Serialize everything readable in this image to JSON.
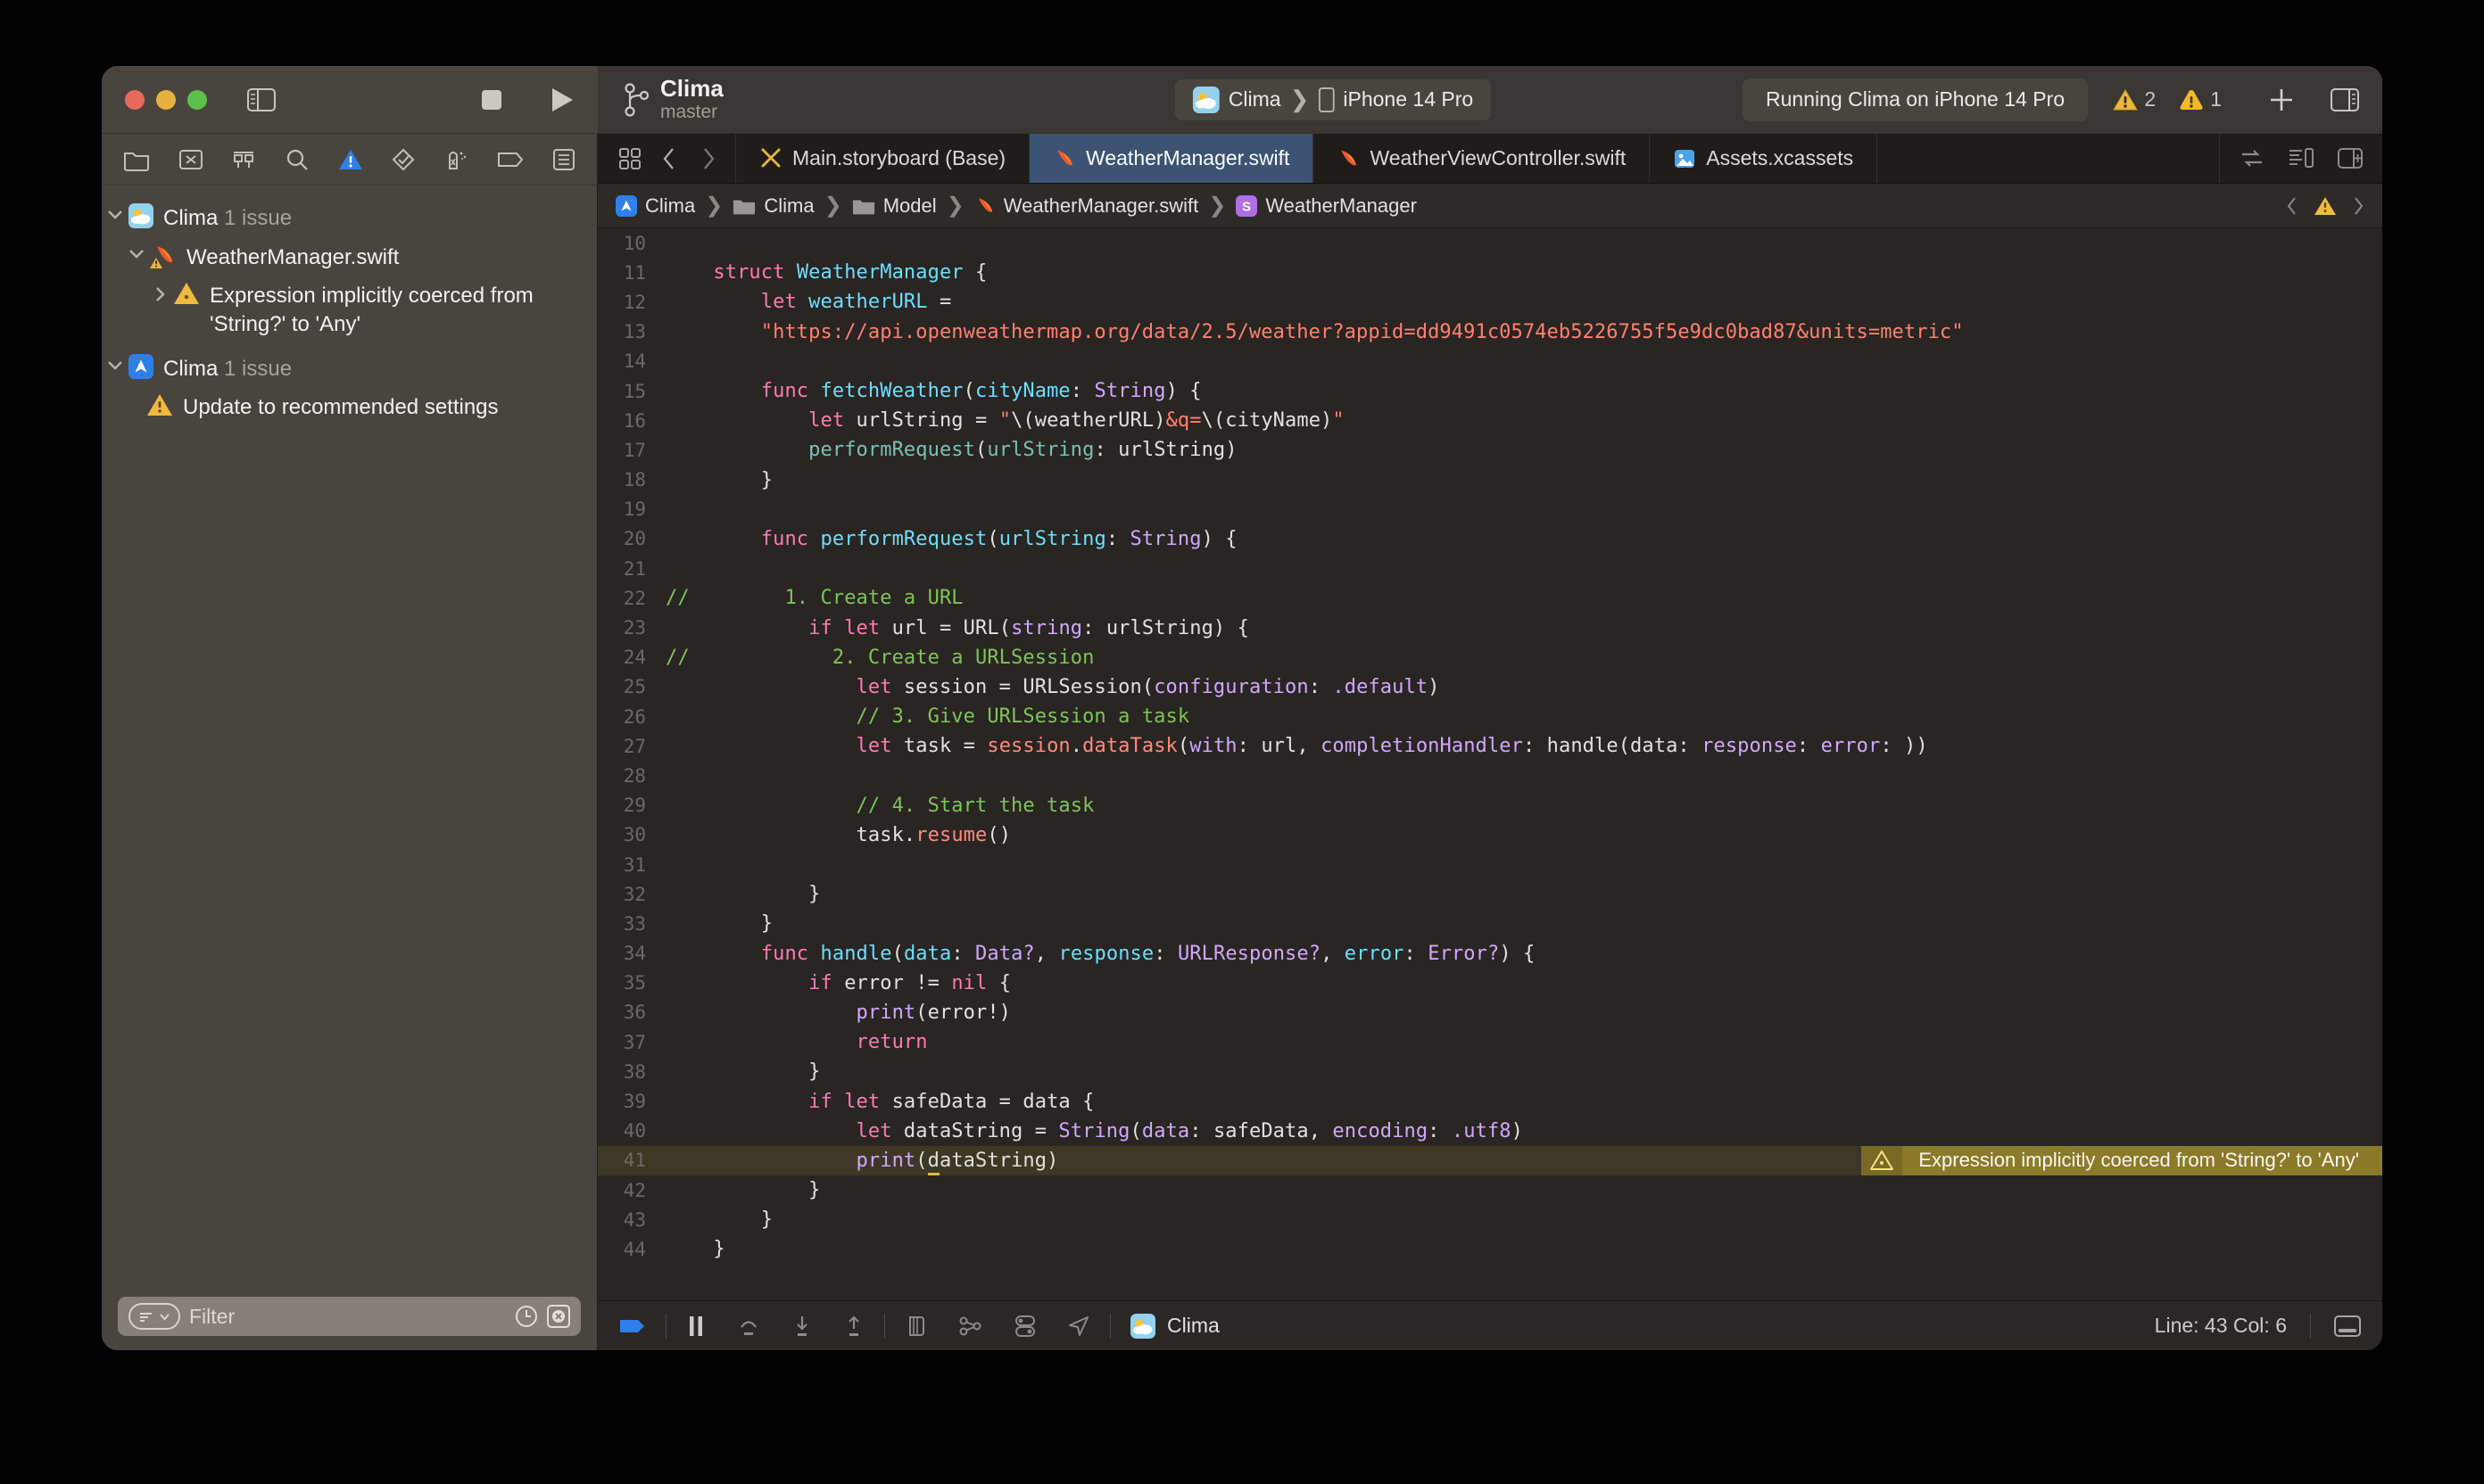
{
  "titlebar": {
    "branch": {
      "project": "Clima",
      "branch_name": "master",
      "icon": "source-control-icon"
    },
    "scheme": {
      "scheme_name": "Clima",
      "destination": "iPhone 14 Pro",
      "separator": "❯"
    },
    "status": "Running Clima on iPhone 14 Pro",
    "badges": [
      {
        "icon": "warning-triangle-icon",
        "count": "2"
      },
      {
        "icon": "warning-round-icon",
        "count": "1"
      }
    ],
    "right_buttons": [
      "add-icon",
      "inspector-toggle-icon"
    ],
    "window_controls": [
      "close",
      "minimize",
      "zoom"
    ],
    "sidebar_toggle": "sidebar-toggle-icon",
    "run_controls": [
      "stop-icon",
      "run-icon"
    ]
  },
  "navigator": {
    "toolbar_icons": [
      "project-navigator-icon",
      "source-control-navigator-icon",
      "symbol-navigator-icon",
      "find-navigator-icon",
      "issue-navigator-icon",
      "test-navigator-icon",
      "debug-navigator-icon",
      "breakpoint-navigator-icon",
      "report-navigator-icon"
    ],
    "active_toolbar_icon": "issue-navigator-icon",
    "tree": [
      {
        "level": 0,
        "twisty": "down",
        "icon": "clima-app-icon",
        "label": "Clima",
        "count": "1 issue"
      },
      {
        "level": 1,
        "twisty": "down",
        "icon": "swift-file-warning-icon",
        "label": "WeatherManager.swift",
        "count": ""
      },
      {
        "level": 2,
        "twisty": "right",
        "icon": "warning-triangle-icon",
        "label": "Expression implicitly coerced from 'String?' to 'Any'",
        "count": ""
      },
      {
        "level": 0,
        "twisty": "down",
        "icon": "xcode-target-icon",
        "label": "Clima",
        "count": "1 issue"
      },
      {
        "level": 1,
        "twisty": "none",
        "icon": "warning-triangle-icon",
        "label": "Update to recommended settings",
        "count": ""
      }
    ],
    "filter": {
      "placeholder": "Filter",
      "chip_icon": "filter-chip-icon",
      "right_icons": [
        "recent-clock-icon",
        "errors-only-icon"
      ]
    }
  },
  "editor": {
    "tabs": [
      {
        "label": "Main.storyboard (Base)",
        "icon": "storyboard-icon",
        "active": false
      },
      {
        "label": "WeatherManager.swift",
        "icon": "swift-icon",
        "active": true
      },
      {
        "label": "WeatherViewController.swift",
        "icon": "swift-icon",
        "active": false
      },
      {
        "label": "Assets.xcassets",
        "icon": "assets-icon",
        "active": false
      }
    ],
    "tab_right_icons": [
      "code-review-icon",
      "minimap-icon",
      "add-editor-icon"
    ],
    "tab_nav_icons": [
      "tab-overview-icon",
      "back-chevron-icon",
      "forward-chevron-icon"
    ],
    "breadcrumb": [
      {
        "label": "Clima",
        "icon": "xcode-project-icon"
      },
      {
        "label": "Clima",
        "icon": "folder-icon"
      },
      {
        "label": "Model",
        "icon": "folder-icon"
      },
      {
        "label": "WeatherManager.swift",
        "icon": "swift-icon"
      },
      {
        "label": "WeatherManager",
        "icon": "struct-s-icon"
      }
    ],
    "breadcrumb_separator": "❯",
    "breadcrumb_right_icons": [
      "prev-issue-chevron-icon",
      "warning-triangle-icon",
      "next-issue-chevron-icon"
    ]
  },
  "code": {
    "first_visible_line": 10,
    "warning_line_number": 41,
    "inline_warning": "Expression implicitly coerced from 'String?' to 'Any'",
    "lines": [
      {
        "n": 10,
        "tokens": []
      },
      {
        "n": 11,
        "tokens": [
          {
            "t": "    ",
            "c": "plain"
          },
          {
            "t": "struct ",
            "c": "kw"
          },
          {
            "t": "WeatherManager",
            "c": "typ"
          },
          {
            "t": " {",
            "c": "plain"
          }
        ]
      },
      {
        "n": 12,
        "tokens": [
          {
            "t": "        ",
            "c": "plain"
          },
          {
            "t": "let ",
            "c": "kw"
          },
          {
            "t": "weatherURL",
            "c": "typ"
          },
          {
            "t": " =",
            "c": "plain"
          }
        ]
      },
      {
        "n": 13,
        "tokens": [
          {
            "t": "        ",
            "c": "plain"
          },
          {
            "t": "\"https://api.openweathermap.org/data/2.5/weather?appid=dd9491c0574eb5226755f5e9dc0bad87&units=metric\"",
            "c": "str"
          }
        ]
      },
      {
        "n": 14,
        "tokens": []
      },
      {
        "n": 15,
        "tokens": [
          {
            "t": "        ",
            "c": "plain"
          },
          {
            "t": "func ",
            "c": "kw"
          },
          {
            "t": "fetchWeather",
            "c": "typ"
          },
          {
            "t": "(",
            "c": "plain"
          },
          {
            "t": "cityName",
            "c": "typ"
          },
          {
            "t": ": ",
            "c": "plain"
          },
          {
            "t": "String",
            "c": "fn"
          },
          {
            "t": ") {",
            "c": "plain"
          }
        ]
      },
      {
        "n": 16,
        "tokens": [
          {
            "t": "            ",
            "c": "plain"
          },
          {
            "t": "let ",
            "c": "kw"
          },
          {
            "t": "urlString = ",
            "c": "plain"
          },
          {
            "t": "\"",
            "c": "str"
          },
          {
            "t": "\\(weatherURL)",
            "c": "plain"
          },
          {
            "t": "&q=",
            "c": "str"
          },
          {
            "t": "\\(cityName)",
            "c": "plain"
          },
          {
            "t": "\"",
            "c": "str"
          }
        ]
      },
      {
        "n": 17,
        "tokens": [
          {
            "t": "            ",
            "c": "plain"
          },
          {
            "t": "performRequest",
            "c": "grn"
          },
          {
            "t": "(",
            "c": "plain"
          },
          {
            "t": "urlString",
            "c": "grn"
          },
          {
            "t": ": urlString)",
            "c": "plain"
          }
        ]
      },
      {
        "n": 18,
        "tokens": [
          {
            "t": "        }",
            "c": "plain"
          }
        ]
      },
      {
        "n": 19,
        "tokens": []
      },
      {
        "n": 20,
        "tokens": [
          {
            "t": "        ",
            "c": "plain"
          },
          {
            "t": "func ",
            "c": "kw"
          },
          {
            "t": "performRequest",
            "c": "typ"
          },
          {
            "t": "(",
            "c": "plain"
          },
          {
            "t": "urlString",
            "c": "typ"
          },
          {
            "t": ": ",
            "c": "plain"
          },
          {
            "t": "String",
            "c": "fn"
          },
          {
            "t": ") {",
            "c": "plain"
          }
        ]
      },
      {
        "n": 21,
        "tokens": []
      },
      {
        "n": 22,
        "tokens": [
          {
            "t": "//",
            "c": "cmt"
          },
          {
            "t": "        1. Create a URL",
            "c": "cmt"
          }
        ],
        "comment_full": true
      },
      {
        "n": 23,
        "tokens": [
          {
            "t": "            ",
            "c": "plain"
          },
          {
            "t": "if let ",
            "c": "kw"
          },
          {
            "t": "url = ",
            "c": "plain"
          },
          {
            "t": "URL",
            "c": "plain"
          },
          {
            "t": "(",
            "c": "plain"
          },
          {
            "t": "string",
            "c": "fn"
          },
          {
            "t": ": urlString) {",
            "c": "plain"
          }
        ]
      },
      {
        "n": 24,
        "tokens": [
          {
            "t": "//",
            "c": "cmt"
          },
          {
            "t": "            2. Create a URLSession",
            "c": "cmt"
          }
        ],
        "comment_full": true
      },
      {
        "n": 25,
        "tokens": [
          {
            "t": "                ",
            "c": "plain"
          },
          {
            "t": "let ",
            "c": "kw"
          },
          {
            "t": "session = ",
            "c": "plain"
          },
          {
            "t": "URLSession",
            "c": "plain"
          },
          {
            "t": "(",
            "c": "plain"
          },
          {
            "t": "configuration",
            "c": "fn"
          },
          {
            "t": ": ",
            "c": "plain"
          },
          {
            "t": ".default",
            "c": "fn"
          },
          {
            "t": ")",
            "c": "plain"
          }
        ]
      },
      {
        "n": 26,
        "tokens": [
          {
            "t": "                ",
            "c": "plain"
          },
          {
            "t": "// 3. Give URLSession a task",
            "c": "cmt"
          }
        ]
      },
      {
        "n": 27,
        "tokens": [
          {
            "t": "                ",
            "c": "plain"
          },
          {
            "t": "let ",
            "c": "kw"
          },
          {
            "t": "task = ",
            "c": "plain"
          },
          {
            "t": "session",
            "c": "mth"
          },
          {
            "t": ".",
            "c": "plain"
          },
          {
            "t": "dataTask",
            "c": "mth"
          },
          {
            "t": "(",
            "c": "plain"
          },
          {
            "t": "with",
            "c": "fn"
          },
          {
            "t": ": url, ",
            "c": "plain"
          },
          {
            "t": "completionHandler",
            "c": "fn"
          },
          {
            "t": ": handle(data: ",
            "c": "plain"
          },
          {
            "t": "response",
            "c": "fn"
          },
          {
            "t": ": ",
            "c": "plain"
          },
          {
            "t": "error",
            "c": "fn"
          },
          {
            "t": ": ))",
            "c": "plain"
          }
        ]
      },
      {
        "n": 28,
        "tokens": []
      },
      {
        "n": 29,
        "tokens": [
          {
            "t": "                ",
            "c": "plain"
          },
          {
            "t": "// 4. Start the task",
            "c": "cmt"
          }
        ]
      },
      {
        "n": 30,
        "tokens": [
          {
            "t": "                ",
            "c": "plain"
          },
          {
            "t": "task",
            "c": "plain"
          },
          {
            "t": ".",
            "c": "plain"
          },
          {
            "t": "resume",
            "c": "mth"
          },
          {
            "t": "()",
            "c": "plain"
          }
        ]
      },
      {
        "n": 31,
        "tokens": []
      },
      {
        "n": 32,
        "tokens": [
          {
            "t": "            }",
            "c": "plain"
          }
        ]
      },
      {
        "n": 33,
        "tokens": [
          {
            "t": "        }",
            "c": "plain"
          }
        ]
      },
      {
        "n": 34,
        "tokens": [
          {
            "t": "        ",
            "c": "plain"
          },
          {
            "t": "func ",
            "c": "kw"
          },
          {
            "t": "handle",
            "c": "typ"
          },
          {
            "t": "(",
            "c": "plain"
          },
          {
            "t": "data",
            "c": "typ"
          },
          {
            "t": ": ",
            "c": "plain"
          },
          {
            "t": "Data?",
            "c": "fn"
          },
          {
            "t": ", ",
            "c": "plain"
          },
          {
            "t": "response",
            "c": "typ"
          },
          {
            "t": ": ",
            "c": "plain"
          },
          {
            "t": "URLResponse?",
            "c": "fn"
          },
          {
            "t": ", ",
            "c": "plain"
          },
          {
            "t": "error",
            "c": "typ"
          },
          {
            "t": ": ",
            "c": "plain"
          },
          {
            "t": "Error?",
            "c": "fn"
          },
          {
            "t": ") {",
            "c": "plain"
          }
        ]
      },
      {
        "n": 35,
        "tokens": [
          {
            "t": "            ",
            "c": "plain"
          },
          {
            "t": "if ",
            "c": "kw"
          },
          {
            "t": "error != ",
            "c": "plain"
          },
          {
            "t": "nil",
            "c": "kw"
          },
          {
            "t": " {",
            "c": "plain"
          }
        ]
      },
      {
        "n": 36,
        "tokens": [
          {
            "t": "                ",
            "c": "plain"
          },
          {
            "t": "print",
            "c": "fn"
          },
          {
            "t": "(error!)",
            "c": "plain"
          }
        ]
      },
      {
        "n": 37,
        "tokens": [
          {
            "t": "                ",
            "c": "plain"
          },
          {
            "t": "return",
            "c": "kw"
          }
        ]
      },
      {
        "n": 38,
        "tokens": [
          {
            "t": "            }",
            "c": "plain"
          }
        ]
      },
      {
        "n": 39,
        "tokens": [
          {
            "t": "            ",
            "c": "plain"
          },
          {
            "t": "if let ",
            "c": "kw"
          },
          {
            "t": "safeData = data {",
            "c": "plain"
          }
        ]
      },
      {
        "n": 40,
        "tokens": [
          {
            "t": "                ",
            "c": "plain"
          },
          {
            "t": "let ",
            "c": "kw"
          },
          {
            "t": "dataString = ",
            "c": "plain"
          },
          {
            "t": "String",
            "c": "fn"
          },
          {
            "t": "(",
            "c": "plain"
          },
          {
            "t": "data",
            "c": "fn"
          },
          {
            "t": ": safeData, ",
            "c": "plain"
          },
          {
            "t": "encoding",
            "c": "fn"
          },
          {
            "t": ": ",
            "c": "plain"
          },
          {
            "t": ".utf8",
            "c": "fn"
          },
          {
            "t": ")",
            "c": "plain"
          }
        ]
      },
      {
        "n": 41,
        "tokens": [
          {
            "t": "                ",
            "c": "plain"
          },
          {
            "t": "print",
            "c": "fn"
          },
          {
            "t": "(",
            "c": "plain"
          },
          {
            "t": "d",
            "c": "plain",
            "warn_underline": true
          },
          {
            "t": "ataString)",
            "c": "plain"
          }
        ]
      },
      {
        "n": 42,
        "tokens": [
          {
            "t": "            }",
            "c": "plain"
          }
        ]
      },
      {
        "n": 43,
        "tokens": [
          {
            "t": "        }",
            "c": "plain"
          }
        ]
      },
      {
        "n": 44,
        "tokens": [
          {
            "t": "    }",
            "c": "plain"
          }
        ]
      }
    ]
  },
  "debugbar": {
    "icons": [
      "hide-debug-area-icon",
      "pause-icon",
      "step-over-icon",
      "step-into-icon",
      "step-out-icon",
      "view-hierarchy-icon",
      "memory-graph-icon",
      "environment-overrides-icon",
      "simulate-location-icon"
    ],
    "app": {
      "label": "Clima",
      "icon": "clima-app-icon"
    },
    "line_col": "Line: 43  Col: 6",
    "right_icon": "console-toggle-icon"
  },
  "colors": {
    "accent_blue": "#3c5373",
    "warning_yellow": "#e7b53c",
    "inline_warning_bg": "#8a7a2a",
    "warning_line_bg": "#3d3826",
    "editor_bg": "#292522",
    "chrome_bg": "#4a443f"
  }
}
